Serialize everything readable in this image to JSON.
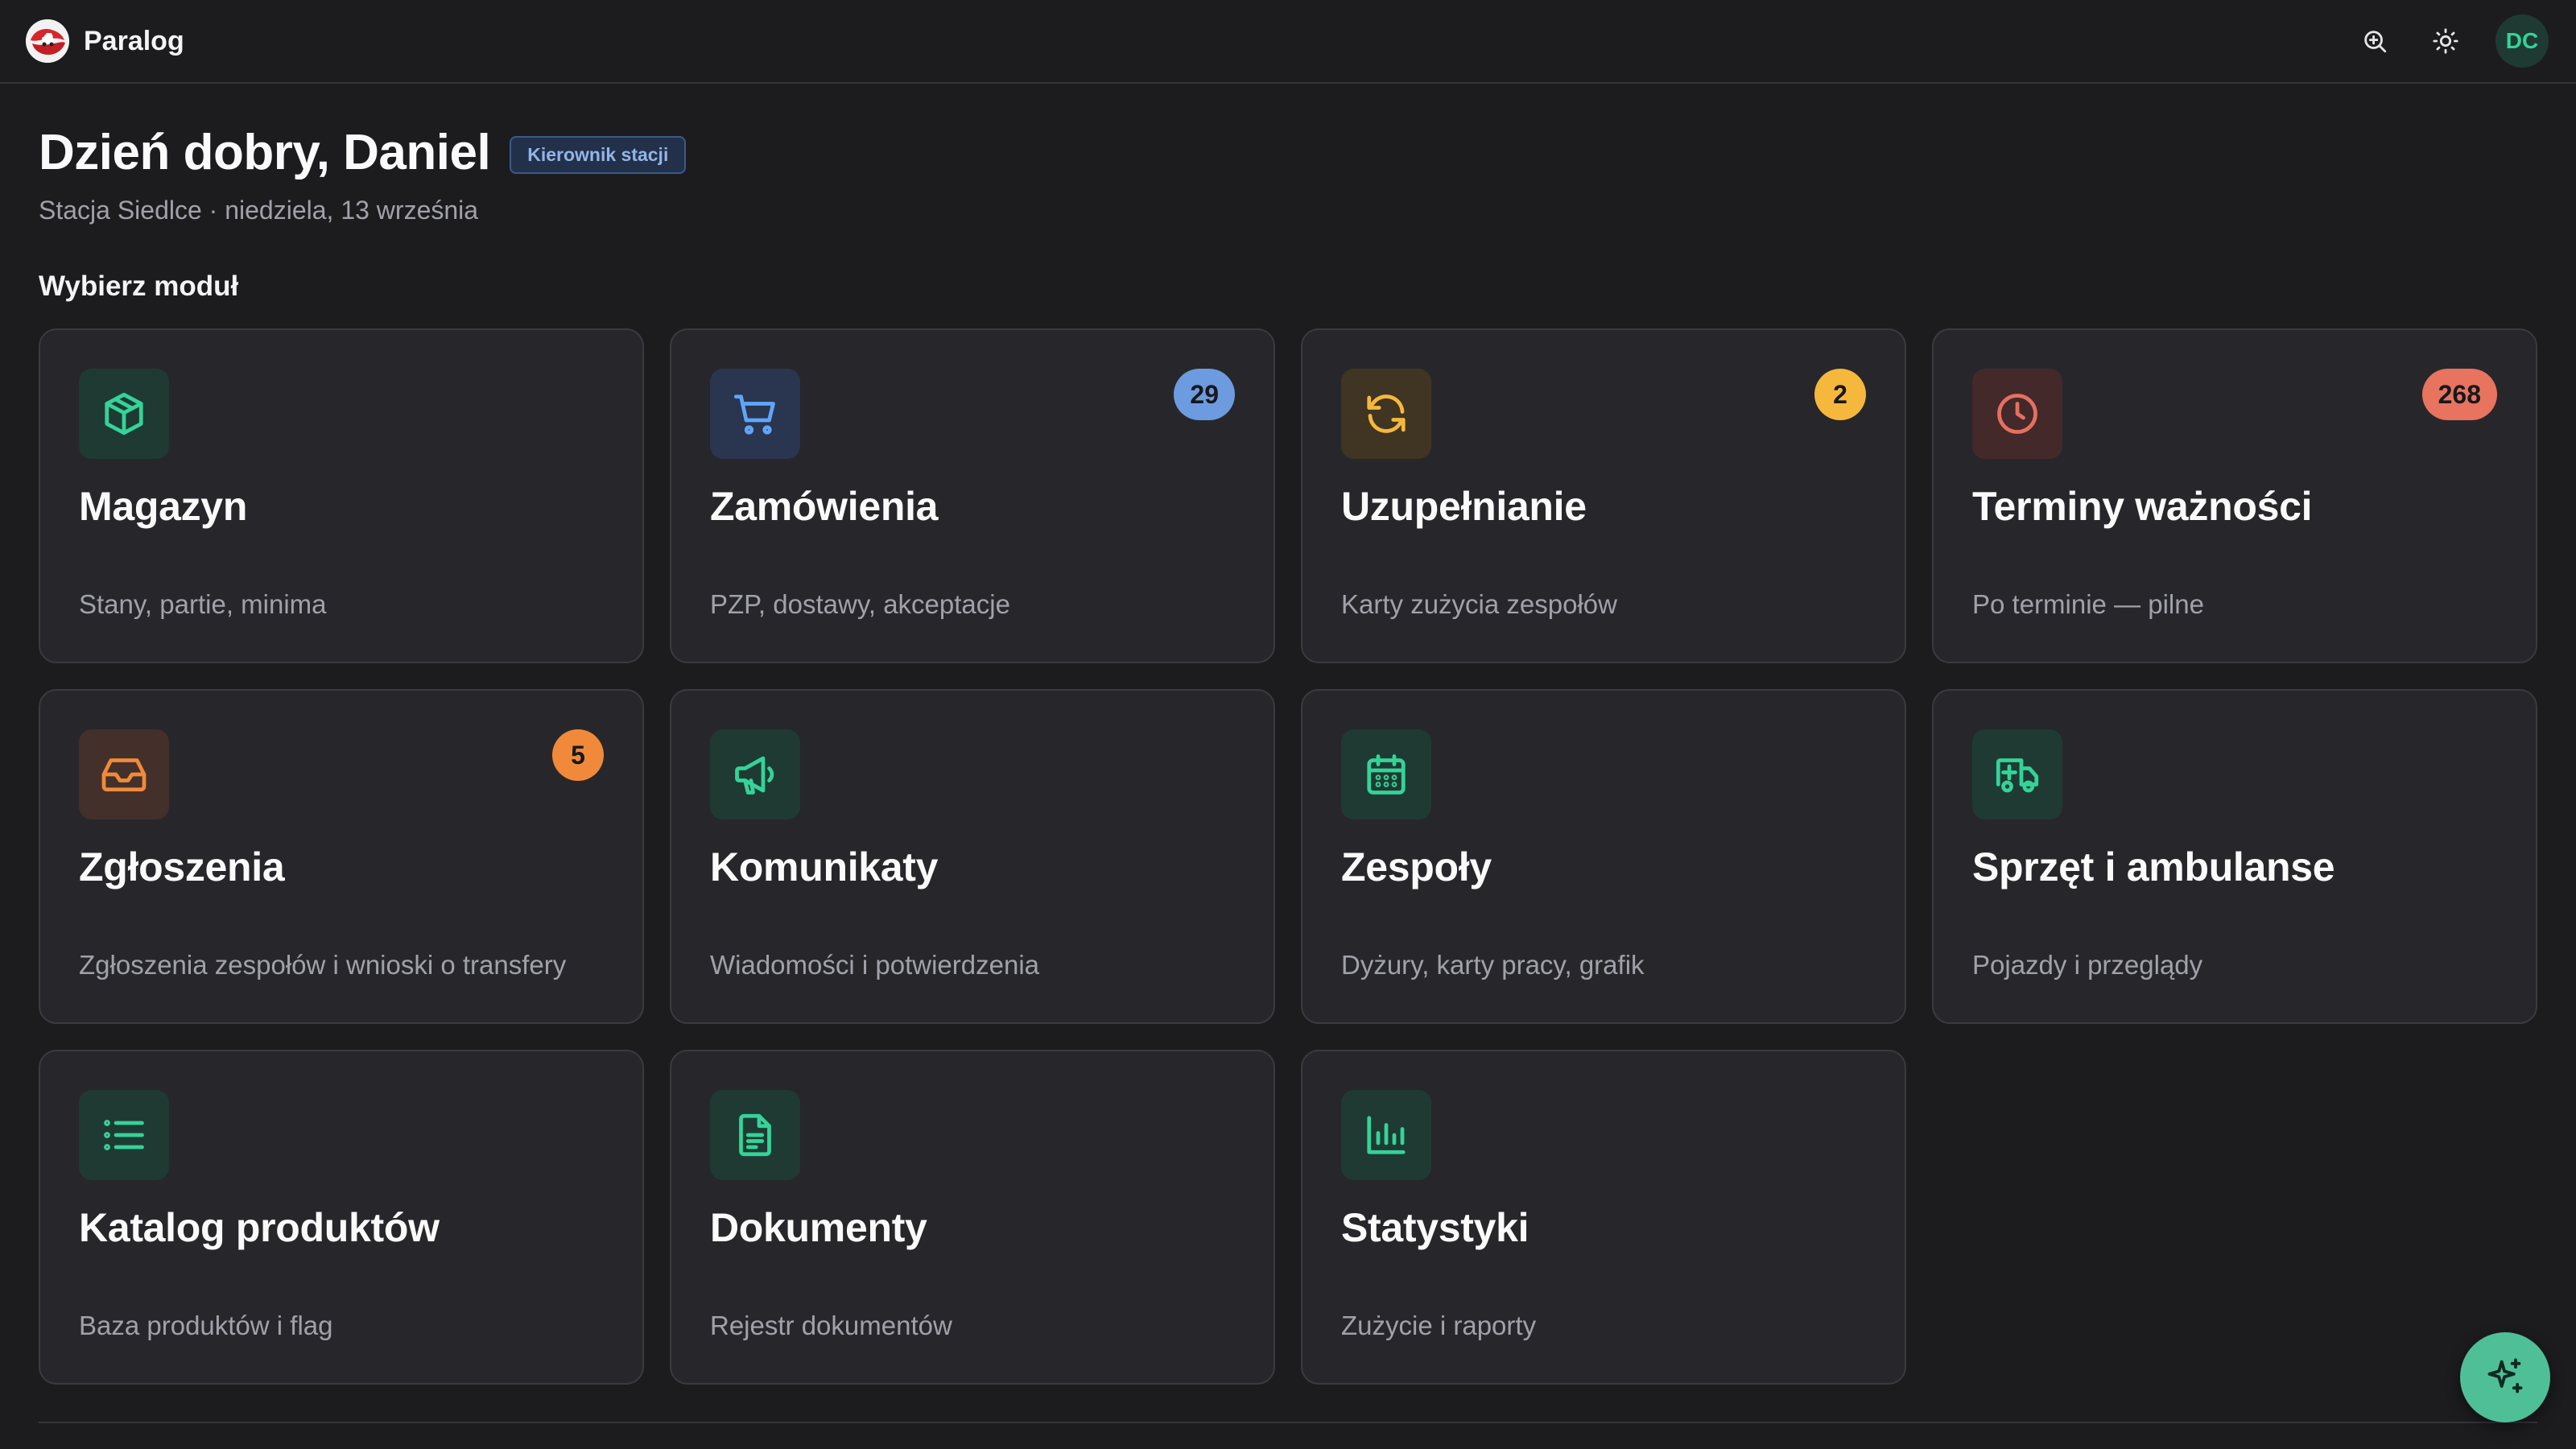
{
  "app": {
    "name": "Paralog"
  },
  "header": {
    "search_icon": "zoom-in-icon",
    "theme_icon": "sun-icon",
    "avatar_initials": "DC"
  },
  "greeting": {
    "title": "Dzień dobry, Daniel",
    "role": "Kierownik stacji",
    "subtitle": "Stacja Siedlce · niedziela, 13 września"
  },
  "section_title": "Wybierz moduł",
  "modules": [
    {
      "title": "Magazyn",
      "desc": "Stany, partie, minima",
      "icon": "box-icon",
      "accent": "#34d399",
      "icon_bg": "#1f3a33",
      "badge": null
    },
    {
      "title": "Zamówienia",
      "desc": "PZP, dostawy, akceptacje",
      "icon": "cart-icon",
      "accent": "#60a5fa",
      "icon_bg": "#2a3550",
      "badge": "29",
      "badge_color": "#6d9be0"
    },
    {
      "title": "Uzupełnianie",
      "desc": "Karty zużycia zespołów",
      "icon": "refresh-icon",
      "accent": "#f5b83d",
      "icon_bg": "#3f3522",
      "badge": "2",
      "badge_color": "#f5b83d"
    },
    {
      "title": "Terminy ważności",
      "desc": "Po terminie — pilne",
      "icon": "clock-icon",
      "accent": "#e5705f",
      "icon_bg": "#43292a",
      "badge": "268",
      "badge_color": "#e8735f"
    },
    {
      "title": "Zgłoszenia",
      "desc": "Zgłoszenia zespołów i wnioski o transfery",
      "icon": "inbox-icon",
      "accent": "#f08a3a",
      "icon_bg": "#43302a",
      "badge": "5",
      "badge_color": "#f08a3a"
    },
    {
      "title": "Komunikaty",
      "desc": "Wiadomości i potwierdzenia",
      "icon": "megaphone-icon",
      "accent": "#34d399",
      "icon_bg": "#1f3a33",
      "badge": null
    },
    {
      "title": "Zespoły",
      "desc": "Dyżury, karty pracy, grafik",
      "icon": "calendar-icon",
      "accent": "#34d399",
      "icon_bg": "#1f3a33",
      "badge": null
    },
    {
      "title": "Sprzęt i ambulanse",
      "desc": "Pojazdy i przeglądy",
      "icon": "ambulance-icon",
      "accent": "#34d399",
      "icon_bg": "#1f3a33",
      "badge": null
    },
    {
      "title": "Katalog produktów",
      "desc": "Baza produktów i flag",
      "icon": "list-icon",
      "accent": "#34d399",
      "icon_bg": "#1f3a33",
      "badge": null
    },
    {
      "title": "Dokumenty",
      "desc": "Rejestr dokumentów",
      "icon": "document-icon",
      "accent": "#34d399",
      "icon_bg": "#1f3a33",
      "badge": null
    },
    {
      "title": "Statystyki",
      "desc": "Zużycie i raporty",
      "icon": "bar-chart-icon",
      "accent": "#34d399",
      "icon_bg": "#1f3a33",
      "badge": null
    }
  ],
  "fab_icon": "sparkles-icon"
}
